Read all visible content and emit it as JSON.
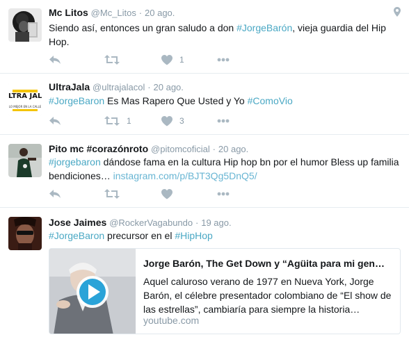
{
  "colors": {
    "hashtag": "#4aa8c4",
    "muted": "#8899a6",
    "action_icon": "#aab8c2",
    "play_button": "#1da1f2"
  },
  "tweets": [
    {
      "fullname": "Mc Litos",
      "handle": "@Mc_Litos",
      "separator": "·",
      "time": "20 ago.",
      "text_before": "Siendo así, entonces un gran saludo a don ",
      "hashtag": "#JorgeBarón",
      "text_after": ", vieja guardia del Hip Hop.",
      "has_geo": true,
      "geo_icon": "location-pin-icon",
      "retweet_count": "",
      "like_count": "1"
    },
    {
      "fullname": "UltraJala",
      "handle": "@ultrajalacol",
      "separator": "·",
      "time": "20 ago.",
      "hashtag1": "#JorgeBaron",
      "text_middle": " Es Mas Rapero Que Usted y Yo ",
      "hashtag2": "#ComoVio",
      "avatar_logo_text": "ULTRA JALA",
      "avatar_logo_sub": "LO MEJOR EN LA CALLE",
      "retweet_count": "1",
      "like_count": "3"
    },
    {
      "fullname": "Pito mc #corazónroto",
      "handle": "@pitomcoficial",
      "separator": "·",
      "time": "20 ago.",
      "hashtag": "#jorgebaron",
      "text_after": "  dándose fama en la cultura Hip hop bn por el humor Bless up familia bendiciones… ",
      "link": "instagram.com/p/BJT3Qg5DnQ5/",
      "retweet_count": "",
      "like_count": ""
    },
    {
      "fullname": "Jose Jaimes",
      "handle": "@RockerVagabundo",
      "separator": "·",
      "time": "19 ago.",
      "hashtag1": "#JorgeBaron",
      "text_middle": " precursor en el ",
      "hashtag2": "#HipHop",
      "card": {
        "title": "Jorge Barón, The Get Down y “Agüita para mi gen…",
        "description": "Aquel caluroso verano de 1977 en Nueva York, Jorge Barón, el célebre presentador colombiano de “El show de las estrellas”, cambiaría para siempre la historia…",
        "domain": "youtube.com",
        "play_icon": "play-button-icon"
      }
    }
  ],
  "icons": {
    "reply": "reply-icon",
    "retweet": "retweet-icon",
    "like": "heart-icon",
    "more": "more-dots-icon"
  }
}
